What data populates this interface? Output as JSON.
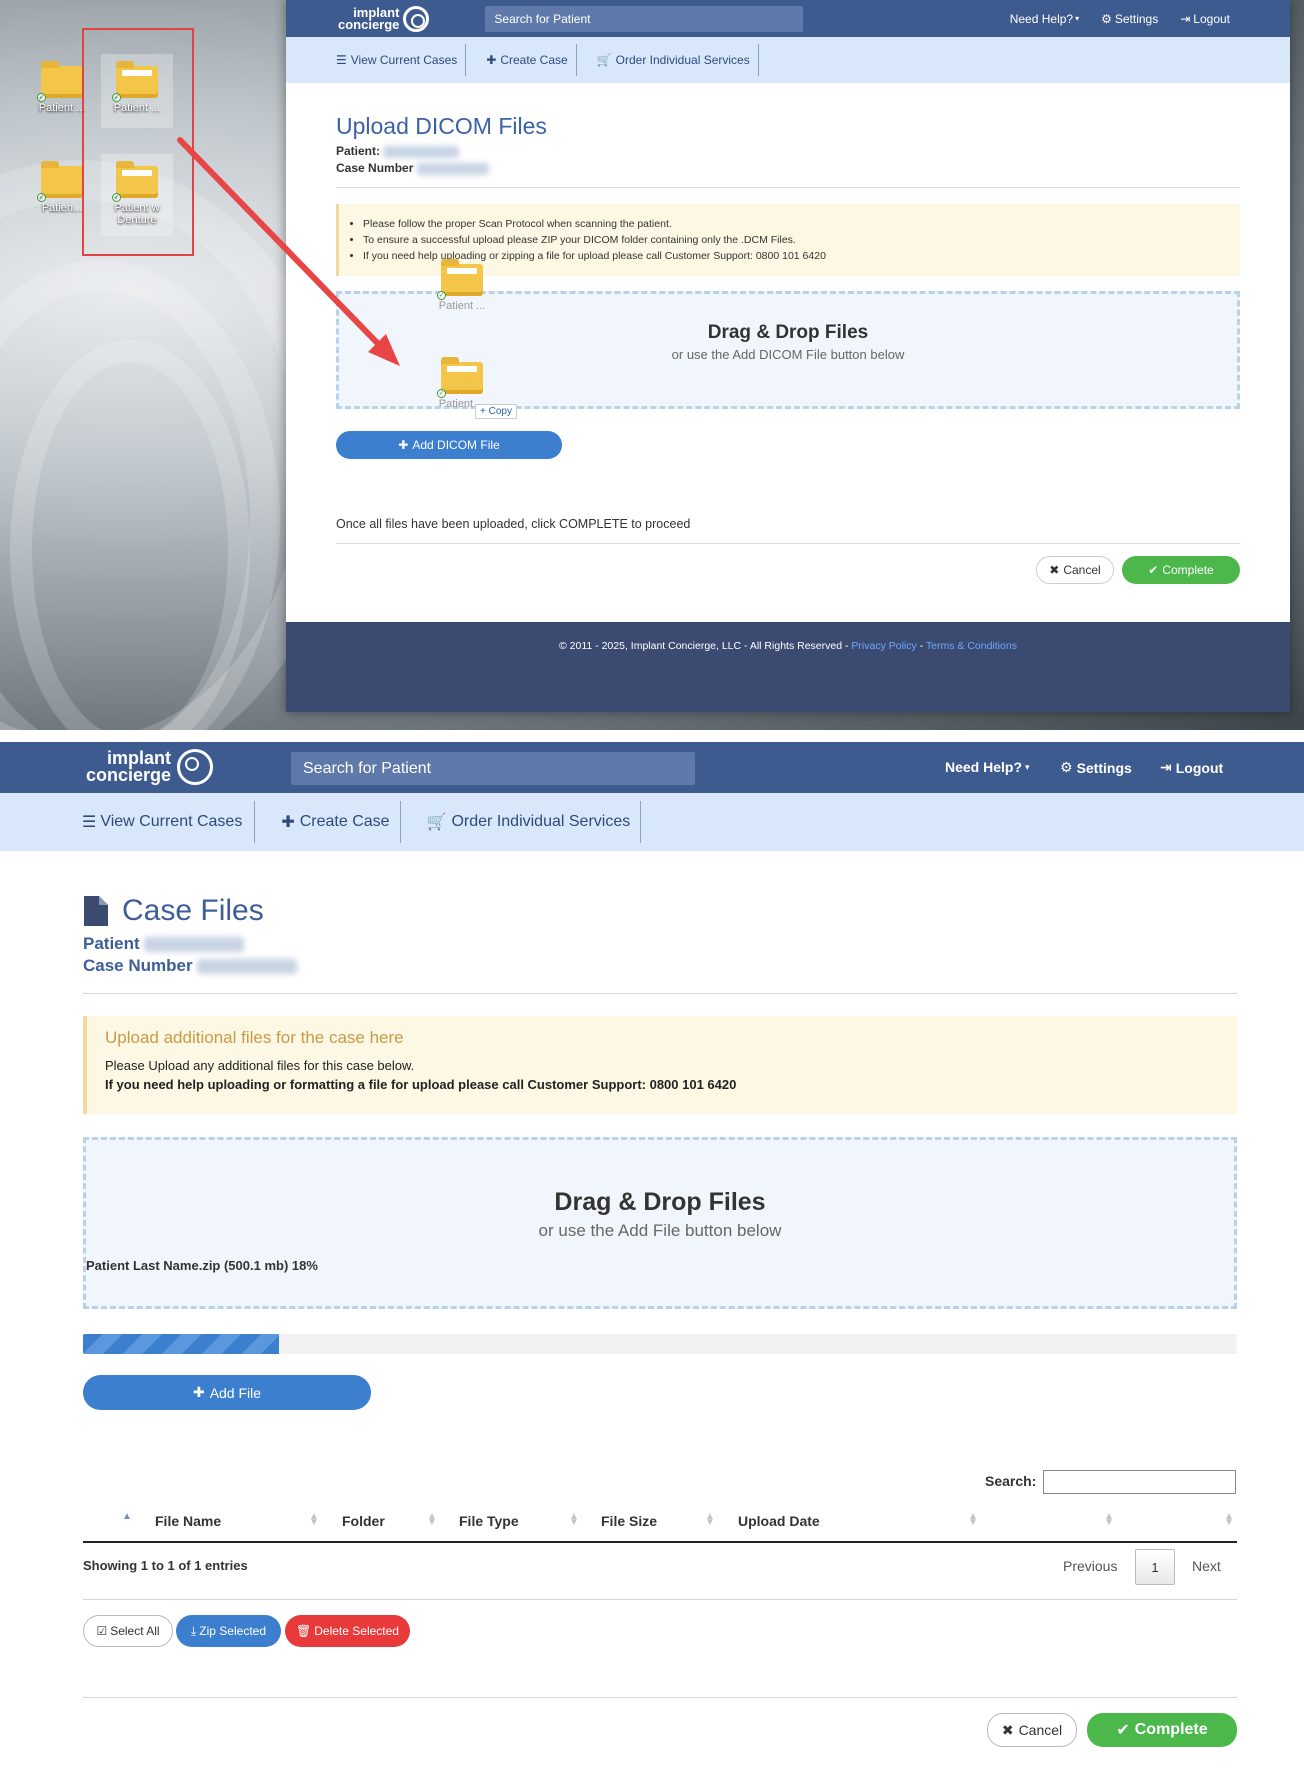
{
  "top_window": {
    "logo_line1": "implant",
    "logo_line2": "concierge",
    "search_placeholder": "Search for Patient",
    "nav": {
      "help": "Need Help?",
      "settings": "Settings",
      "logout": "Logout"
    },
    "subnav": [
      "View Current Cases",
      "Create Case",
      "Order Individual Services"
    ],
    "title": "Upload DICOM Files",
    "patient_label": "Patient:",
    "case_label": "Case Number",
    "notices": [
      "Please follow the proper Scan Protocol when scanning the patient.",
      "To ensure a successful upload please ZIP your DICOM folder containing only the .DCM Files.",
      "If you need help uploading or zipping a file for upload please call Customer Support: 0800 101 6420"
    ],
    "dropzone_title": "Drag & Drop Files",
    "dropzone_sub": "or use the Add DICOM File button below",
    "drag_item1": "Patient ...",
    "drag_item2": "Patient ...",
    "drag_copy": "+ Copy",
    "add_button": "Add DICOM File",
    "once_text": "Once all files have been uploaded, click COMPLETE to proceed",
    "cancel": "Cancel",
    "complete": "Complete",
    "footer_text": "© 2011 - 2025, Implant Concierge, LLC - All Rights Reserved - ",
    "footer_privacy": "Privacy Policy",
    "footer_sep": " - ",
    "footer_terms": "Terms & Conditions"
  },
  "desktop": {
    "icons": [
      {
        "label": "Patient ..."
      },
      {
        "label": "Patient ..."
      },
      {
        "label": "Patien..."
      },
      {
        "label": "Patient w Denture"
      }
    ]
  },
  "bottom_window": {
    "logo_line1": "implant",
    "logo_line2": "concierge",
    "search_placeholder": "Search for Patient",
    "nav": {
      "help": "Need Help?",
      "settings": "Settings",
      "logout": "Logout"
    },
    "subnav": [
      "View Current Cases",
      "Create Case",
      "Order Individual Services"
    ],
    "title": "Case Files",
    "patient_label": "Patient",
    "case_label": "Case Number",
    "notice_title": "Upload additional files for the case here",
    "notice_lines": [
      "Please Upload any additional files for this case below.",
      "If you need help uploading or formatting a file for upload please call Customer Support: 0800 101 6420"
    ],
    "dropzone_title": "Drag & Drop Files",
    "dropzone_sub": "or use the Add File button below",
    "upload_file": "Patient Last Name.zip (500.1 mb)",
    "upload_percent": "18%",
    "progress": 0.17,
    "add_button": "Add File",
    "search_label": "Search:",
    "columns": [
      "File Name",
      "Folder",
      "File Type",
      "File Size",
      "Upload Date"
    ],
    "showing": "Showing 1 to 1 of 1 entries",
    "prev": "Previous",
    "page": "1",
    "next": "Next",
    "select_all": "Select All",
    "zip_selected": "Zip Selected",
    "delete_selected": "Delete Selected",
    "cancel": "Cancel",
    "complete": "Complete"
  },
  "colors": {
    "navbar": "#3e5b8f",
    "subnav": "#d9e7fb",
    "accent_blue": "#3d7fcf",
    "success_green": "#4cb84c",
    "danger_red": "#e83a3a",
    "notice_title": "#c89a4a"
  }
}
